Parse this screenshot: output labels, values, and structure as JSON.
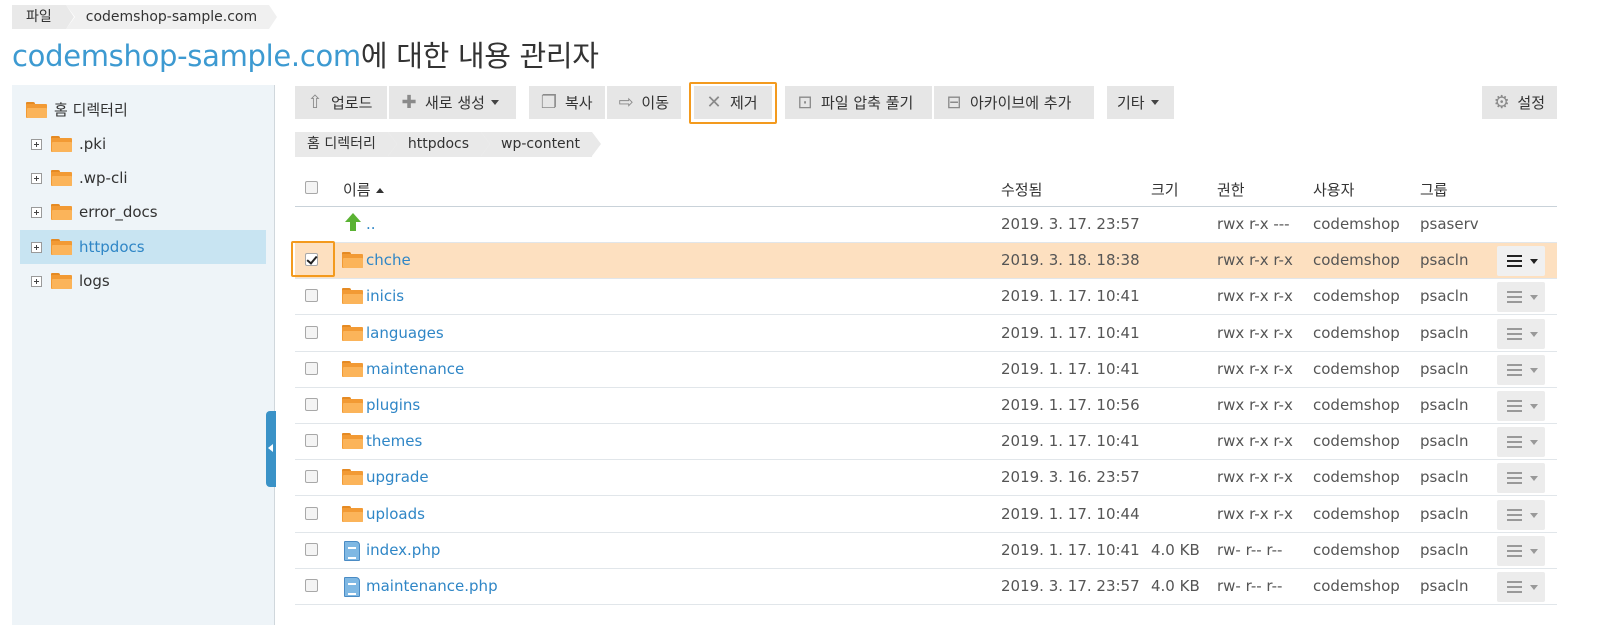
{
  "top_breadcrumb": {
    "root": "파일",
    "current": "codemshop-sample.com"
  },
  "title": {
    "domain": "codemshop-sample.com",
    "suffix": "에 대한 내용 관리자"
  },
  "sidebar": {
    "root": "홈 디렉터리",
    "items": [
      {
        "label": ".pki"
      },
      {
        "label": ".wp-cli"
      },
      {
        "label": "error_docs"
      },
      {
        "label": "httpdocs",
        "selected": true
      },
      {
        "label": "logs"
      }
    ]
  },
  "toolbar": {
    "upload": "업로드",
    "new": "새로 생성",
    "copy": "복사",
    "move": "이동",
    "remove": "제거",
    "extract": "파일 압축 풀기",
    "archive": "아카이브에 추가",
    "more": "기타",
    "settings": "설정"
  },
  "path": [
    "홈 디렉터리",
    "httpdocs",
    "wp-content"
  ],
  "table": {
    "headers": {
      "name": "이름",
      "modified": "수정됨",
      "size": "크기",
      "perm": "권한",
      "user": "사용자",
      "group": "그룹"
    },
    "rows": [
      {
        "name": "..",
        "modified": "2019. 3. 17. 23:57",
        "size": "",
        "perm": "rwx r-x ---",
        "user": "codemshop",
        "group": "psaserv",
        "type": "parent"
      },
      {
        "name": "chche",
        "modified": "2019. 3. 18. 18:38",
        "size": "",
        "perm": "rwx r-x r-x",
        "user": "codemshop",
        "group": "psacln",
        "type": "folder",
        "checked": true
      },
      {
        "name": "inicis",
        "modified": "2019. 1. 17. 10:41",
        "size": "",
        "perm": "rwx r-x r-x",
        "user": "codemshop",
        "group": "psacln",
        "type": "folder"
      },
      {
        "name": "languages",
        "modified": "2019. 1. 17. 10:41",
        "size": "",
        "perm": "rwx r-x r-x",
        "user": "codemshop",
        "group": "psacln",
        "type": "folder"
      },
      {
        "name": "maintenance",
        "modified": "2019. 1. 17. 10:41",
        "size": "",
        "perm": "rwx r-x r-x",
        "user": "codemshop",
        "group": "psacln",
        "type": "folder"
      },
      {
        "name": "plugins",
        "modified": "2019. 1. 17. 10:56",
        "size": "",
        "perm": "rwx r-x r-x",
        "user": "codemshop",
        "group": "psacln",
        "type": "folder"
      },
      {
        "name": "themes",
        "modified": "2019. 1. 17. 10:41",
        "size": "",
        "perm": "rwx r-x r-x",
        "user": "codemshop",
        "group": "psacln",
        "type": "folder"
      },
      {
        "name": "upgrade",
        "modified": "2019. 3. 16. 23:57",
        "size": "",
        "perm": "rwx r-x r-x",
        "user": "codemshop",
        "group": "psacln",
        "type": "folder"
      },
      {
        "name": "uploads",
        "modified": "2019. 1. 17. 10:44",
        "size": "",
        "perm": "rwx r-x r-x",
        "user": "codemshop",
        "group": "psacln",
        "type": "folder"
      },
      {
        "name": "index.php",
        "modified": "2019. 1. 17. 10:41",
        "size": "4.0 KB",
        "perm": "rw- r-- r--",
        "user": "codemshop",
        "group": "psacln",
        "type": "file"
      },
      {
        "name": "maintenance.php",
        "modified": "2019. 3. 17. 23:57",
        "size": "4.0 KB",
        "perm": "rw- r-- r--",
        "user": "codemshop",
        "group": "psacln",
        "type": "file"
      }
    ]
  },
  "icons": {
    "folder": "folder-icon",
    "parent": "up-arrow-icon",
    "file": "php-file-icon",
    "row_menu": "hamburger-menu-icon"
  },
  "colors": {
    "accent": "#3d9ad1",
    "highlight": "#f39a1e",
    "selected_row": "#fde0c0",
    "folder": "#f29a34"
  }
}
